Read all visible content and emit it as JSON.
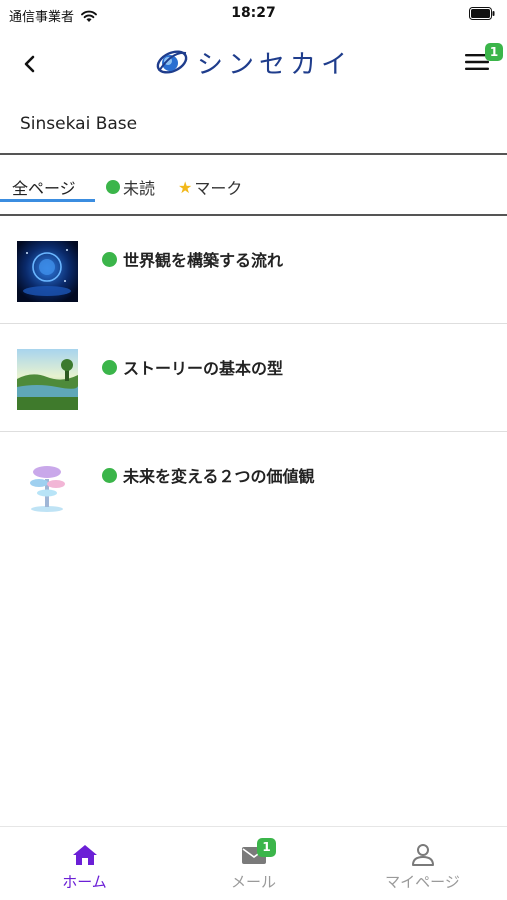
{
  "status_bar": {
    "carrier": "通信事業者",
    "time": "18:27",
    "wifi_icon": "wifi-icon",
    "battery_icon": "battery-icon"
  },
  "nav": {
    "back_icon": "chevron-left-icon",
    "logo_text": "シンセカイ",
    "menu_icon": "hamburger-menu-icon",
    "menu_badge": "1"
  },
  "section": {
    "title": "Sinsekai Base"
  },
  "tabs": [
    {
      "label": "全ページ",
      "active": true
    },
    {
      "label": "未読",
      "icon": "green-dot-icon"
    },
    {
      "label": "マーク",
      "icon": "star-icon"
    }
  ],
  "items": [
    {
      "title": "世界観を構築する流れ",
      "status_icon": "unread-dot-icon"
    },
    {
      "title": "ストーリーの基本の型",
      "status_icon": "unread-dot-icon"
    },
    {
      "title": "未来を変える２つの価値観",
      "status_icon": "unread-dot-icon"
    }
  ],
  "tabbar": [
    {
      "label": "ホーム",
      "icon": "home-icon",
      "active": true
    },
    {
      "label": "メール",
      "icon": "mail-icon",
      "badge": "1"
    },
    {
      "label": "マイページ",
      "icon": "user-icon"
    }
  ],
  "colors": {
    "accent_purple": "#6b1fd6",
    "unread_green": "#3bb54a",
    "tab_indicator": "#3b8de0",
    "star": "#f2b81a"
  }
}
